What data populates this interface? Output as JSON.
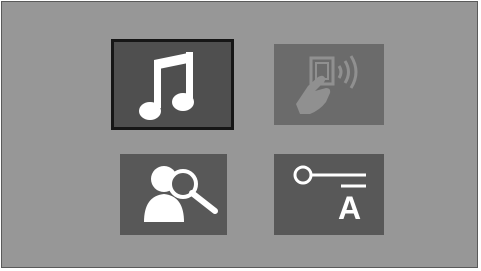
{
  "tiles": [
    {
      "id": "music",
      "icon": "music-note-icon",
      "state": "selected"
    },
    {
      "id": "wireless",
      "icon": "tap-to-connect-icon",
      "state": "disabled"
    },
    {
      "id": "search",
      "icon": "user-search-icon",
      "state": "normal"
    },
    {
      "id": "key",
      "icon": "key-icon",
      "state": "normal",
      "letter": "A"
    }
  ],
  "colors": {
    "background": "#979797",
    "tile": "#585858",
    "tile_disabled": "#6b6b6b",
    "selection_border": "#161616",
    "icon": "#ffffff",
    "icon_disabled": "#909090"
  }
}
